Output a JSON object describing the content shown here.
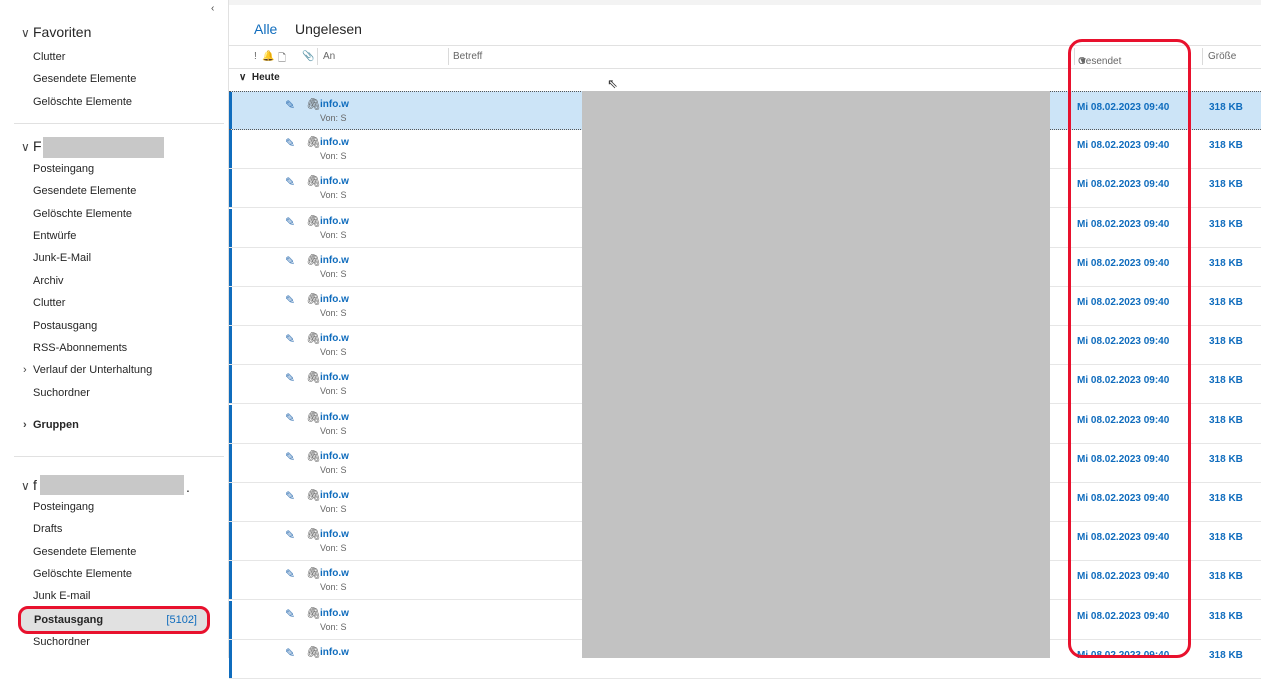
{
  "sidebar": {
    "collapse_glyph": "‹",
    "favorites": {
      "label": "Favoriten",
      "items": [
        "Clutter",
        "Gesendete Elemente",
        "Gelöschte Elemente"
      ]
    },
    "account1": {
      "label_visible": "F",
      "items": [
        "Posteingang",
        "Gesendete Elemente",
        "Gelöschte Elemente",
        "Entwürfe",
        "Junk-E-Mail",
        "Archiv",
        "Clutter",
        "Postausgang",
        "RSS-Abonnements"
      ],
      "expandable": [
        "Verlauf der Unterhaltung"
      ],
      "after": [
        "Suchordner"
      ]
    },
    "groups_label": "Gruppen",
    "account2": {
      "label_visible": "f",
      "trailing": ".",
      "items": [
        "Posteingang",
        "Drafts",
        "Gesendete Elemente",
        "Gelöschte Elemente",
        "Junk E-mail"
      ],
      "selected": {
        "label": "Postausgang",
        "count": "[5102]"
      },
      "after": [
        "Suchordner"
      ]
    }
  },
  "main": {
    "filters": {
      "all": "Alle",
      "unread": "Ungelesen"
    },
    "columns": {
      "importance": "!",
      "reminder": "🔔",
      "type": "🗋",
      "attachment": "📎",
      "to": "An",
      "subject": "Betreff",
      "sent": "Gesendet",
      "sort_glyph": "▼",
      "size": "Größe"
    },
    "group_label": "Heute",
    "rows": [
      {
        "to": "info.w",
        "from": "Von: S",
        "date": "Mi 08.02.2023 09:40",
        "size": "318 KB"
      },
      {
        "to": "info.w",
        "from": "Von: S",
        "date": "Mi 08.02.2023 09:40",
        "size": "318 KB"
      },
      {
        "to": "info.w",
        "from": "Von: S",
        "date": "Mi 08.02.2023 09:40",
        "size": "318 KB"
      },
      {
        "to": "info.w",
        "from": "Von: S",
        "date": "Mi 08.02.2023 09:40",
        "size": "318 KB"
      },
      {
        "to": "info.w",
        "from": "Von: S",
        "date": "Mi 08.02.2023 09:40",
        "size": "318 KB"
      },
      {
        "to": "info.w",
        "from": "Von: S",
        "date": "Mi 08.02.2023 09:40",
        "size": "318 KB"
      },
      {
        "to": "info.w",
        "from": "Von: S",
        "date": "Mi 08.02.2023 09:40",
        "size": "318 KB"
      },
      {
        "to": "info.w",
        "from": "Von: S",
        "date": "Mi 08.02.2023 09:40",
        "size": "318 KB"
      },
      {
        "to": "info.w",
        "from": "Von: S",
        "date": "Mi 08.02.2023 09:40",
        "size": "318 KB"
      },
      {
        "to": "info.w",
        "from": "Von: S",
        "date": "Mi 08.02.2023 09:40",
        "size": "318 KB"
      },
      {
        "to": "info.w",
        "from": "Von: S",
        "date": "Mi 08.02.2023 09:40",
        "size": "318 KB"
      },
      {
        "to": "info.w",
        "from": "Von: S",
        "date": "Mi 08.02.2023 09:40",
        "size": "318 KB"
      },
      {
        "to": "info.w",
        "from": "Von: S",
        "date": "Mi 08.02.2023 09:40",
        "size": "318 KB"
      },
      {
        "to": "info.w",
        "from": "Von: S",
        "date": "Mi 08.02.2023 09:40",
        "size": "318 KB"
      },
      {
        "to": "info.w",
        "from": "",
        "date": "Mi 08.02.2023 09:40",
        "size": "318 KB"
      }
    ],
    "icons": {
      "draft": "✎",
      "attachment": "🖇"
    },
    "accent_color": "#0f6cbd",
    "highlight_color": "#e8112d"
  }
}
